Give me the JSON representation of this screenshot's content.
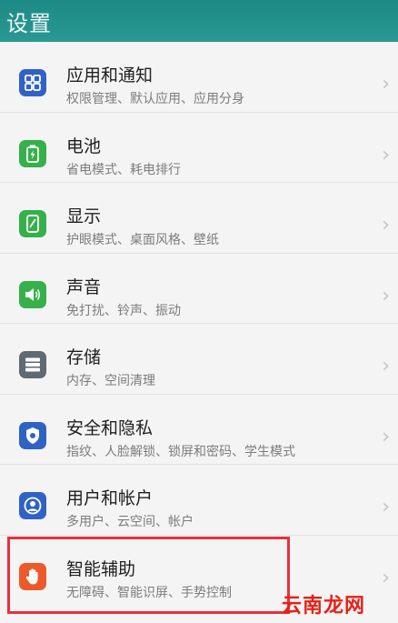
{
  "header": {
    "title": "设置"
  },
  "items": [
    {
      "title": "应用和通知",
      "subtitle": "权限管理、默认应用、应用分身",
      "icon": "apps-grid-icon",
      "color": "#2f62c4"
    },
    {
      "title": "电池",
      "subtitle": "省电模式、耗电排行",
      "icon": "battery-icon",
      "color": "#36b04a"
    },
    {
      "title": "显示",
      "subtitle": "护眼模式、桌面风格、壁纸",
      "icon": "display-icon",
      "color": "#36b04a"
    },
    {
      "title": "声音",
      "subtitle": "免打扰、铃声、振动",
      "icon": "speaker-icon",
      "color": "#36b04a"
    },
    {
      "title": "存储",
      "subtitle": "内存、空间清理",
      "icon": "storage-icon",
      "color": "#5f6a73"
    },
    {
      "title": "安全和隐私",
      "subtitle": "指纹、人脸解锁、锁屏和密码、学生模式",
      "icon": "shield-icon",
      "color": "#2f62c4"
    },
    {
      "title": "用户和帐户",
      "subtitle": "多用户、云空间、帐户",
      "icon": "user-icon",
      "color": "#2f62c4"
    },
    {
      "title": "智能辅助",
      "subtitle": "无障碍、智能识屏、手势控制",
      "icon": "hand-icon",
      "color": "#ea5a2a"
    }
  ],
  "watermark": "云南龙网"
}
